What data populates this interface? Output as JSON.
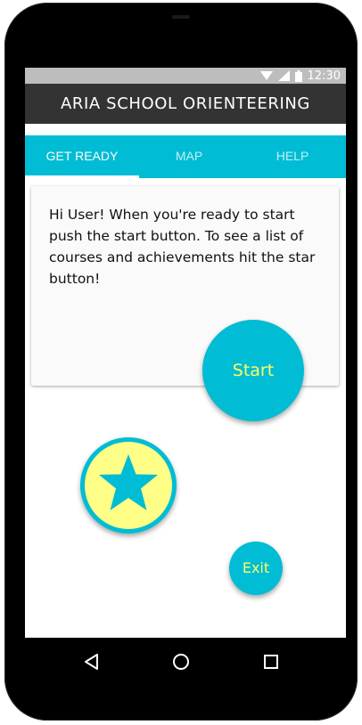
{
  "status_bar": {
    "time": "12:30",
    "icons": [
      "wifi-icon",
      "signal-icon",
      "battery-icon"
    ]
  },
  "app_bar": {
    "title": "ARIA SCHOOL ORIENTEERING"
  },
  "tabs": [
    {
      "label": "GET READY",
      "active": true
    },
    {
      "label": "MAP",
      "active": false
    },
    {
      "label": "HELP",
      "active": false
    }
  ],
  "card": {
    "text": "Hi User! When you're ready to start push the start button. To see a list of courses and achievements hit the star button!"
  },
  "buttons": {
    "start_label": "Start",
    "star_icon": "star-icon",
    "exit_label": "Exit"
  },
  "nav_bar": {
    "icons": [
      "back-icon",
      "home-icon",
      "recents-icon"
    ]
  },
  "colors": {
    "accent": "#00bcd4",
    "button_text": "#ffff66",
    "star_fill": "#ffff88",
    "app_bar": "#333333"
  }
}
